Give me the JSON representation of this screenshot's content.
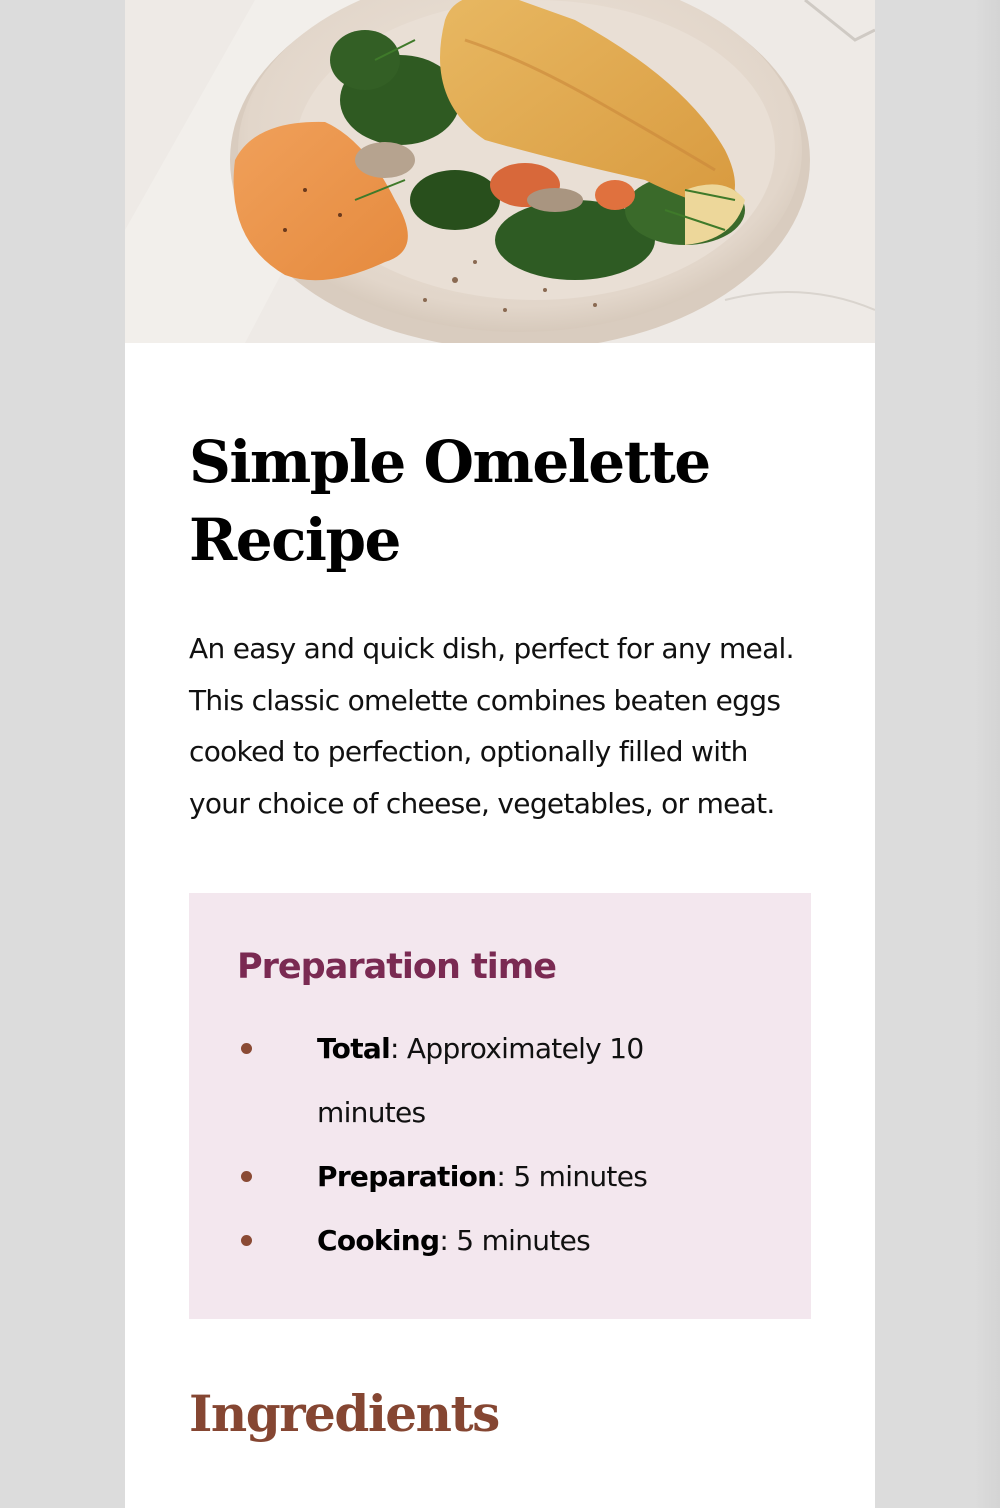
{
  "hero": {
    "image_subject": "omelette-with-spinach-and-hummus-photo"
  },
  "recipe": {
    "title": "Simple Omelette Recipe",
    "description": "An easy and quick dish, perfect for any meal. This classic omelette combines beaten eggs cooked to perfection, optionally filled with your choice of cheese, vegetables, or meat."
  },
  "preparation": {
    "heading": "Preparation time",
    "items": [
      {
        "label": "Total",
        "value": ": Approximately 10 minutes"
      },
      {
        "label": "Preparation",
        "value": ": 5 minutes"
      },
      {
        "label": "Cooking",
        "value": ": 5 minutes"
      }
    ]
  },
  "ingredients": {
    "heading": "Ingredients"
  },
  "colors": {
    "page_background": "#dcdcdc",
    "card_background": "#ffffff",
    "prep_box_background": "#f3e7ee",
    "prep_heading": "#7a2a52",
    "bullet": "#8a4a34",
    "ingredients_heading": "#854632"
  }
}
